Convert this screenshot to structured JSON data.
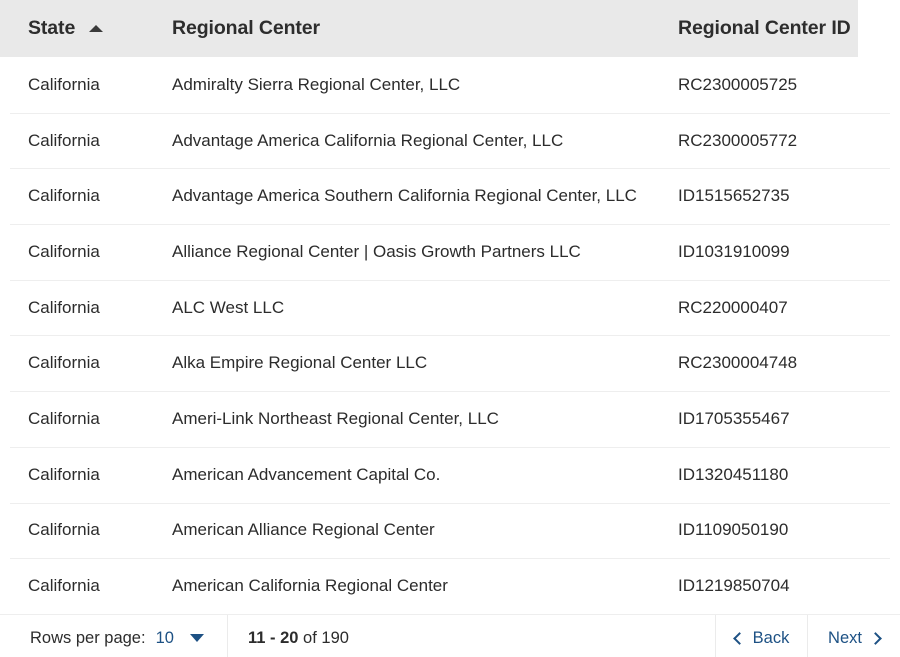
{
  "table": {
    "columns": [
      {
        "key": "state",
        "label": "State",
        "sort": "ascending",
        "sort_icon": "triangle-up-icon"
      },
      {
        "key": "center",
        "label": "Regional Center",
        "sort": "none"
      },
      {
        "key": "id",
        "label": "Regional Center ID",
        "sort": "none"
      }
    ],
    "rows": [
      {
        "state": "California",
        "center": "Admiralty Sierra Regional Center, LLC",
        "id": "RC2300005725"
      },
      {
        "state": "California",
        "center": "Advantage America California Regional Center, LLC",
        "id": "RC2300005772"
      },
      {
        "state": "California",
        "center": "Advantage America Southern California Regional Center, LLC",
        "id": "ID1515652735"
      },
      {
        "state": "California",
        "center": "Alliance Regional Center | Oasis Growth Partners LLC",
        "id": "ID1031910099"
      },
      {
        "state": "California",
        "center": "ALC West LLC",
        "id": "RC220000407"
      },
      {
        "state": "California",
        "center": "Alka Empire Regional Center LLC",
        "id": "RC2300004748"
      },
      {
        "state": "California",
        "center": "Ameri-Link Northeast Regional Center, LLC",
        "id": "ID1705355467"
      },
      {
        "state": "California",
        "center": "American Advancement Capital Co.",
        "id": "ID1320451180"
      },
      {
        "state": "California",
        "center": "American Alliance Regional Center",
        "id": "ID1109050190"
      },
      {
        "state": "California",
        "center": "American California Regional Center",
        "id": "ID1219850704"
      }
    ]
  },
  "footer": {
    "rows_per_page_label": "Rows per page:",
    "rows_per_page_value": "10",
    "caret_icon": "chevron-down-icon",
    "range_start_end": "11 - 20",
    "range_total": " of 190",
    "back_label": "Back",
    "back_icon": "chevron-left-icon",
    "next_label": "Next",
    "next_icon": "chevron-right-icon"
  },
  "colors": {
    "header_bg": "#e9e9e9",
    "link": "#1d5184",
    "text": "#2c2c2c",
    "row_divider": "#eeeeee"
  }
}
